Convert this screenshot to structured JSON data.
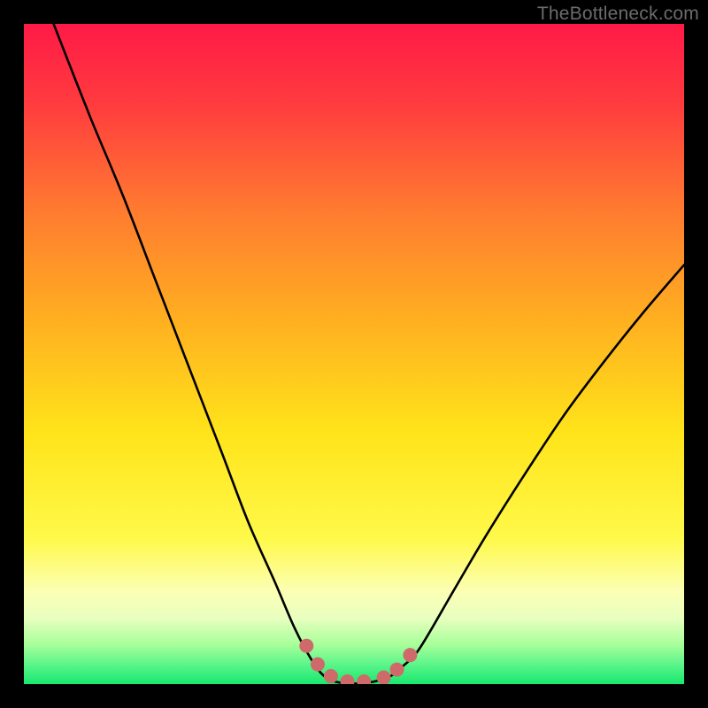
{
  "watermark": "TheBottleneck.com",
  "chart_data": {
    "type": "line",
    "title": "",
    "xlabel": "",
    "ylabel": "",
    "xlim": [
      0,
      1
    ],
    "ylim": [
      0,
      1
    ],
    "gradient_stops": [
      {
        "offset": 0.0,
        "color": "#ff1a47"
      },
      {
        "offset": 0.12,
        "color": "#ff3b3f"
      },
      {
        "offset": 0.28,
        "color": "#ff7a30"
      },
      {
        "offset": 0.45,
        "color": "#ffb020"
      },
      {
        "offset": 0.62,
        "color": "#ffe41a"
      },
      {
        "offset": 0.78,
        "color": "#fff94a"
      },
      {
        "offset": 0.86,
        "color": "#fcffb5"
      },
      {
        "offset": 0.9,
        "color": "#e8ffbf"
      },
      {
        "offset": 0.94,
        "color": "#a8ff9a"
      },
      {
        "offset": 0.97,
        "color": "#5cf58a"
      },
      {
        "offset": 1.0,
        "color": "#18e86f"
      }
    ],
    "series": [
      {
        "name": "bottleneck-curve",
        "x": [
          0.045,
          0.1,
          0.15,
          0.2,
          0.25,
          0.3,
          0.34,
          0.38,
          0.41,
          0.435,
          0.455,
          0.48,
          0.52,
          0.555,
          0.575,
          0.6,
          0.65,
          0.7,
          0.76,
          0.82,
          0.88,
          0.94,
          1.0
        ],
        "y": [
          1.0,
          0.86,
          0.74,
          0.61,
          0.48,
          0.35,
          0.245,
          0.155,
          0.085,
          0.038,
          0.012,
          0.002,
          0.002,
          0.012,
          0.028,
          0.055,
          0.14,
          0.225,
          0.32,
          0.41,
          0.49,
          0.565,
          0.635
        ]
      }
    ],
    "marker_points": {
      "name": "trough-markers",
      "color": "#cf6a6a",
      "radius_px": 8,
      "x": [
        0.428,
        0.445,
        0.465,
        0.49,
        0.515,
        0.545,
        0.565,
        0.585
      ],
      "y": [
        0.058,
        0.03,
        0.012,
        0.004,
        0.004,
        0.01,
        0.022,
        0.044
      ]
    }
  }
}
